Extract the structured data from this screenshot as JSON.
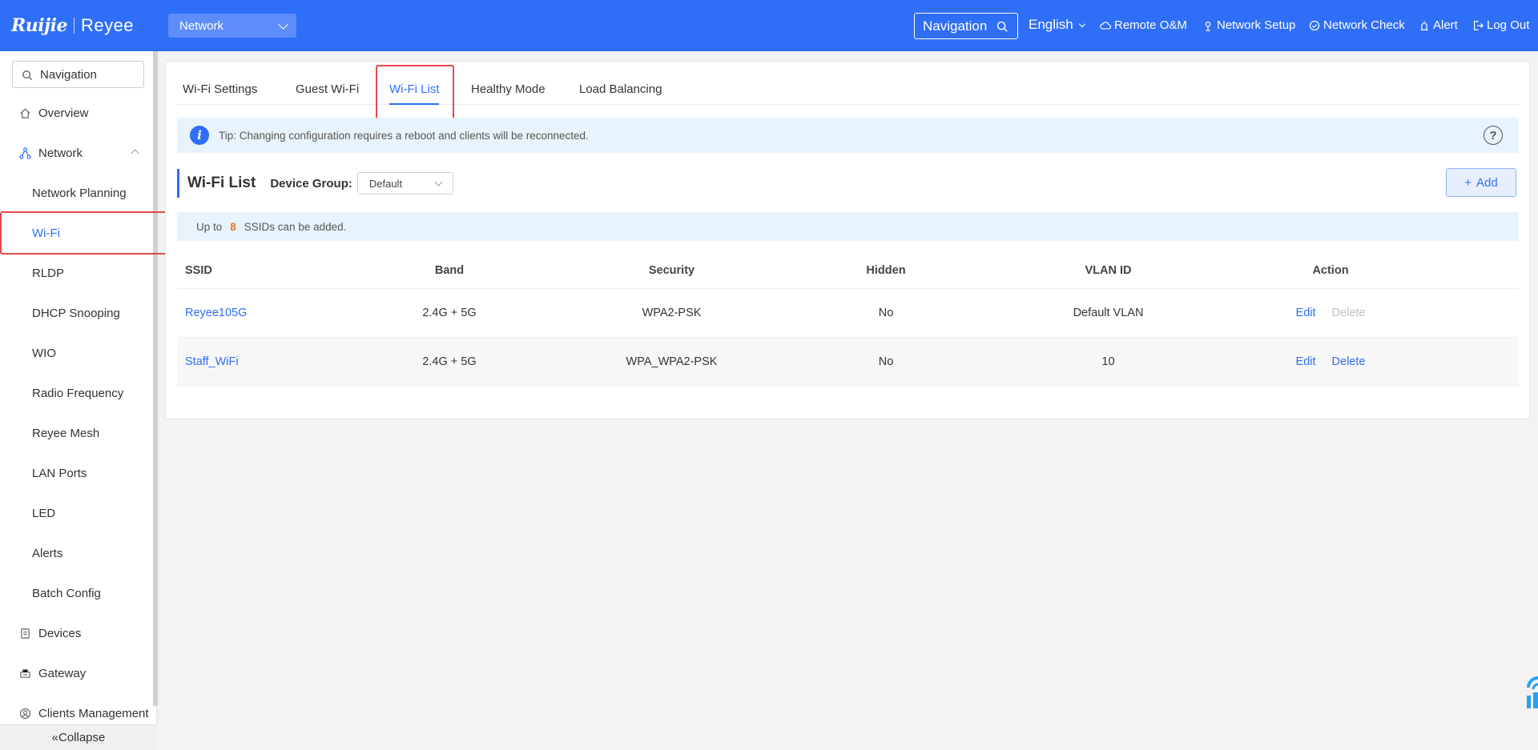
{
  "topbar": {
    "brand_primary": "Ruijie",
    "brand_secondary": "Reyee",
    "network_select": "Network",
    "navigation_search": "Navigation",
    "language": "English",
    "links": {
      "remote": "Remote O&M",
      "setup": "Network Setup",
      "check": "Network Check",
      "alert": "Alert",
      "logout": "Log Out"
    }
  },
  "sidebar": {
    "search_placeholder": "Navigation",
    "items": {
      "overview": "Overview",
      "network": "Network",
      "network_planning": "Network Planning",
      "wifi": "Wi-Fi",
      "rldp": "RLDP",
      "dhcp": "DHCP Snooping",
      "wio": "WIO",
      "radio": "Radio Frequency",
      "mesh": "Reyee Mesh",
      "lan": "LAN Ports",
      "led": "LED",
      "alerts": "Alerts",
      "batch": "Batch Config",
      "devices": "Devices",
      "gateway": "Gateway",
      "clients": "Clients Management"
    },
    "collapse": "«Collapse"
  },
  "tabs": {
    "settings": "Wi-Fi Settings",
    "guest": "Guest Wi-Fi",
    "list": "Wi-Fi List",
    "healthy": "Healthy Mode",
    "balancing": "Load Balancing"
  },
  "tip": "Tip: Changing configuration requires a reboot and clients will be reconnected.",
  "wifi_list": {
    "title": "Wi-Fi List",
    "device_group_label": "Device Group:",
    "device_group_value": "Default",
    "add_button": "Add",
    "limit_prefix": "Up to",
    "limit_number": "8",
    "limit_suffix": "SSIDs can be added."
  },
  "table": {
    "headers": {
      "ssid": "SSID",
      "band": "Band",
      "security": "Security",
      "hidden": "Hidden",
      "vlan": "VLAN ID",
      "action": "Action"
    },
    "rows": [
      {
        "ssid": "Reyee105G",
        "band": "2.4G + 5G",
        "security": "WPA2-PSK",
        "hidden": "No",
        "vlan": "Default VLAN",
        "edit": "Edit",
        "delete": "Delete"
      },
      {
        "ssid": "Staff_WiFi",
        "band": "2.4G + 5G",
        "security": "WPA_WPA2-PSK",
        "hidden": "No",
        "vlan": "10",
        "edit": "Edit",
        "delete": "Delete"
      }
    ]
  },
  "colors": {
    "brand_blue": "#2f6ef6",
    "highlight_red": "#e5484d",
    "limit_orange": "#e8722a"
  }
}
